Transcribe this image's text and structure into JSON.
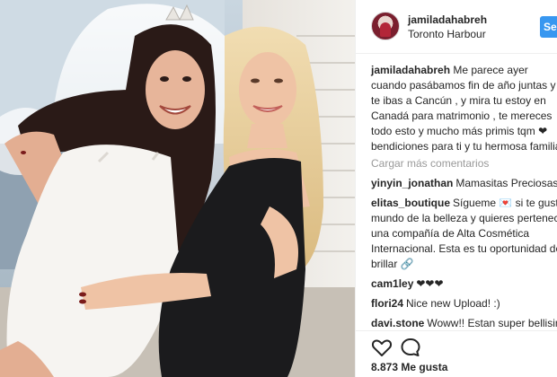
{
  "post": {
    "username": "jamiladahabreh",
    "location": "Toronto Harbour",
    "follow_label": "Seguir"
  },
  "caption": {
    "username": "jamiladahabreh",
    "text": "Me parece ayer cuando pasábamos fin de año juntas y te ibas a Cancún , y mira tu estoy en Canadá para matrimonio , te mereces todo esto y mucho más primis tqm ❤ bendiciones para ti y tu hermosa familia"
  },
  "load_more_label": "Cargar más comentarios",
  "comments": [
    {
      "username": "yinyin_jonathan",
      "text": "Mamasitas Preciosas 😘❤"
    },
    {
      "username": "elitas_boutique",
      "text": "Sígueme 💌 si te gusta el mundo de la belleza y quieres pertenecer a una compañía de Alta Cosmética Internacional. Esta es tu oportunidad de brillar 🔗"
    },
    {
      "username": "cam1ley",
      "text": "❤❤❤"
    },
    {
      "username": "flori24",
      "text": "Nice new Upload! :)"
    },
    {
      "username": "davi.stone",
      "text": "Woww!! Estan super bellisimas"
    }
  ],
  "likes_label": "8.873 Me gusta",
  "colors": {
    "accent": "#3897f0",
    "muted": "#999999",
    "text": "#262626"
  },
  "icons": {
    "like": "heart-outline",
    "comment": "speech-bubble"
  }
}
